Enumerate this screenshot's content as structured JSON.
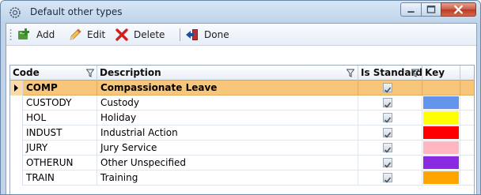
{
  "window": {
    "title": "Default other types"
  },
  "toolbar": {
    "items": [
      {
        "label": "Add",
        "icon": "add-icon"
      },
      {
        "label": "Edit",
        "icon": "edit-icon"
      },
      {
        "label": "Delete",
        "icon": "delete-icon"
      },
      {
        "label": "Done",
        "icon": "done-icon"
      }
    ]
  },
  "grid": {
    "columns": [
      "Code",
      "Description",
      "Is Standard",
      "Key"
    ],
    "rows": [
      {
        "code": "COMP",
        "description": "Compassionate Leave",
        "is_standard": true,
        "key_color": "#f8c67a",
        "selected": true
      },
      {
        "code": "CUSTODY",
        "description": "Custody",
        "is_standard": true,
        "key_color": "#6495ed"
      },
      {
        "code": "HOL",
        "description": "Holiday",
        "is_standard": true,
        "key_color": "#ffff00"
      },
      {
        "code": "INDUST",
        "description": "Industrial Action",
        "is_standard": true,
        "key_color": "#ff0000"
      },
      {
        "code": "JURY",
        "description": "Jury Service",
        "is_standard": true,
        "key_color": "#ffb6c1"
      },
      {
        "code": "OTHERUN",
        "description": "Other Unspecified",
        "is_standard": true,
        "key_color": "#8a2be2"
      },
      {
        "code": "TRAIN",
        "description": "Training",
        "is_standard": true,
        "key_color": "#ffa500"
      }
    ]
  },
  "colors": {
    "selected_row": "#f8c67a",
    "title_bar": "#bed3ea",
    "close_button": "#c75a45"
  }
}
